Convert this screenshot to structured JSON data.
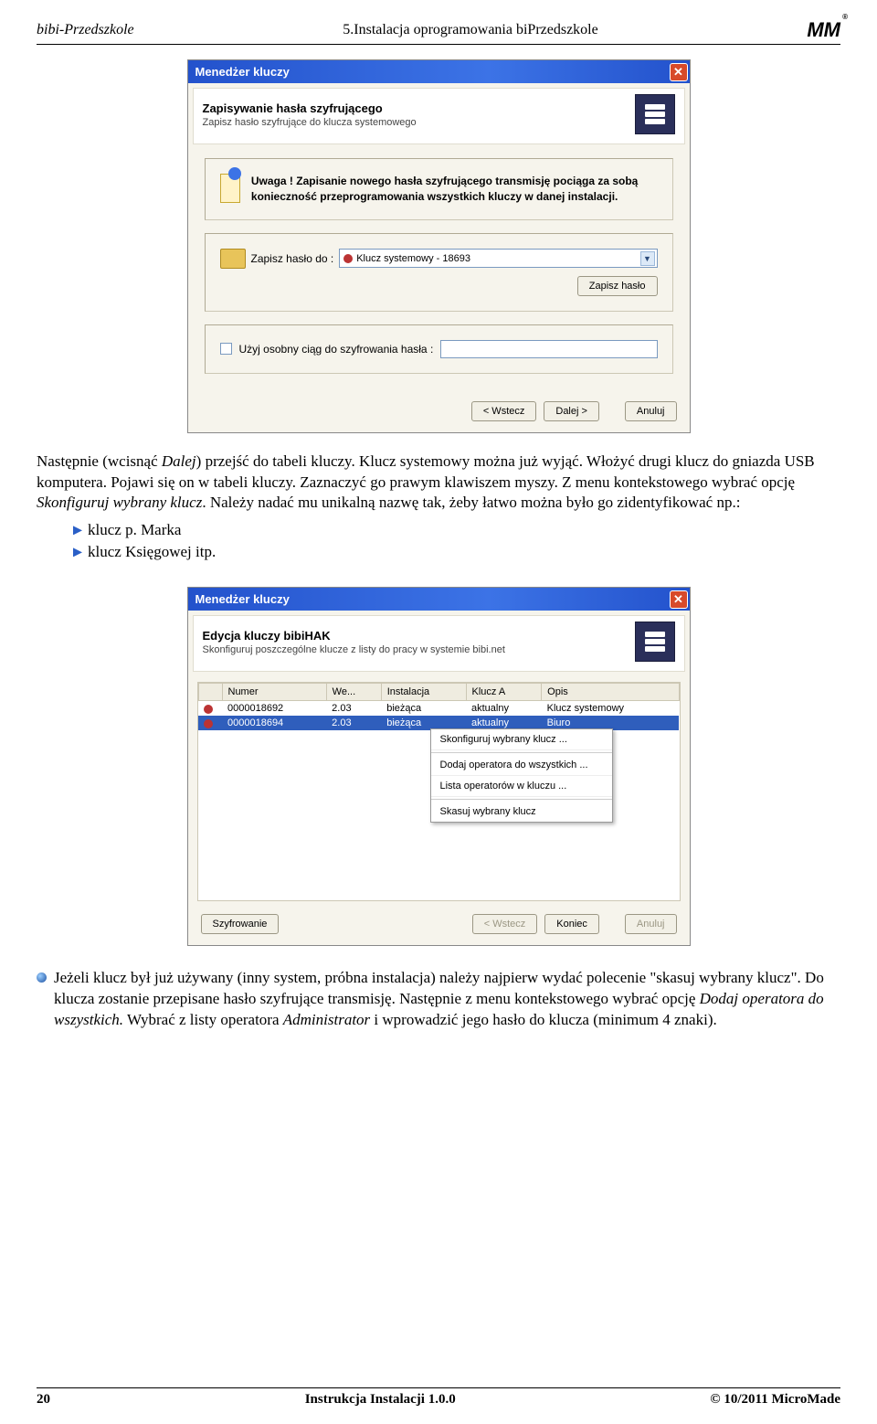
{
  "header": {
    "left": "bibi-Przedszkole",
    "center": "5.Instalacja oprogramowania biPrzedszkole",
    "logo_reg": "®"
  },
  "dialog1": {
    "title": "Menedżer kluczy",
    "band_title": "Zapisywanie hasła szyfrującego",
    "band_sub": "Zapisz hasło szyfrujące do klucza systemowego",
    "warn_prefix": "Uwaga !   ",
    "warn_text": "Zapisanie nowego hasła szyfrującego transmisję pociąga za sobą konieczność przeprogramowania wszystkich kluczy w danej instalacji.",
    "save_label": "Zapisz hasło do :",
    "combo_value": "Klucz systemowy - 18693",
    "save_btn": "Zapisz hasło",
    "custom_key_label": "Użyj osobny ciąg do szyfrowania hasła :",
    "custom_key_value": "",
    "btn_back": "< Wstecz",
    "btn_next": "Dalej >",
    "btn_cancel": "Anuluj"
  },
  "text1": {
    "p1a": "Następnie (wcisnąć ",
    "p1b": "Dalej",
    "p1c": ") przejść do tabeli kluczy. Klucz systemowy można już wyjąć. Włożyć drugi klucz do gniazda USB komputera. Pojawi się on w tabeli kluczy. Zaznaczyć go prawym klawiszem myszy. Z menu kontekstowego wybrać opcję ",
    "p1d": "Skonfiguruj wybrany klucz",
    "p1e": ". Należy nadać mu unikalną nazwę tak, żeby łatwo można było go zidentyfikować np.:",
    "b1": "klucz p. Marka",
    "b2": "klucz Księgowej  itp."
  },
  "dialog2": {
    "title": "Menedżer kluczy",
    "band_title": "Edycja kluczy bibiHAK",
    "band_sub": "Skonfiguruj poszczególne klucze z listy do pracy w systemie bibi.net",
    "cols": {
      "num": "Numer",
      "ver": "We...",
      "inst": "Instalacja",
      "keya": "Klucz A",
      "opis": "Opis"
    },
    "rows": [
      {
        "num": "0000018692",
        "ver": "2.03",
        "inst": "bieżąca",
        "keya": "aktualny",
        "opis": "Klucz systemowy",
        "selected": false
      },
      {
        "num": "0000018694",
        "ver": "2.03",
        "inst": "bieżąca",
        "keya": "aktualny",
        "opis": "Biuro",
        "selected": true
      }
    ],
    "menu": {
      "m1": "Skonfiguruj wybrany klucz ...",
      "m2": "Dodaj operatora do wszystkich ...",
      "m3": "Lista operatorów w kluczu ...",
      "m4": "Skasuj wybrany klucz"
    },
    "btn_enc": "Szyfrowanie",
    "btn_back": "< Wstecz",
    "btn_end": "Koniec",
    "btn_cancel": "Anuluj"
  },
  "text2": {
    "tip_a": "Jeżeli klucz był już używany (inny system, próbna instalacja) należy najpierw wydać polecenie \"skasuj wybrany klucz\". Do klucza zostanie przepisane hasło szyfrujące transmisję. Następnie z menu kontekstowego wybrać opcję ",
    "tip_b": "Dodaj operatora do wszystkich.",
    "tip_c": " Wybrać z listy operatora ",
    "tip_d": "Administrator",
    "tip_e": " i wprowadzić jego hasło do klucza (minimum 4 znaki)."
  },
  "footer": {
    "page": "20",
    "center": "Instrukcja Instalacji   1.0.0",
    "right": "© 10/2011 MicroMade"
  }
}
